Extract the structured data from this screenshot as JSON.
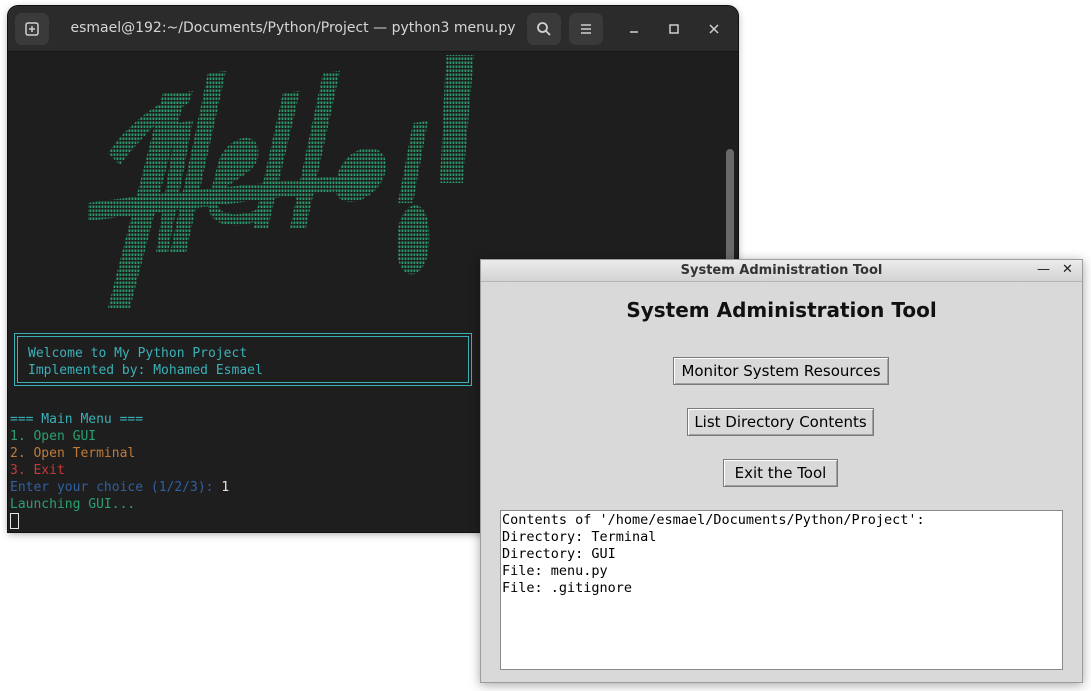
{
  "terminal": {
    "title": "esmael@192:~/Documents/Python/Project — python3 menu.py",
    "icons": {
      "new_tab": "new-tab-icon",
      "search": "search-icon",
      "menu": "hamburger-menu-icon",
      "minimize": "minimize-icon",
      "maximize": "maximize-icon",
      "close": "close-icon"
    },
    "welcome": {
      "line1": "Welcome to My Python Project",
      "line2": "Implemented by: Mohamed Esmael"
    },
    "menu": {
      "header": "=== Main Menu ===",
      "option1": "1. Open GUI",
      "option2": "2. Open Terminal",
      "option3": "3. Exit",
      "prompt": "Enter your choice (1/2/3): ",
      "choice": "1",
      "status": "Launching GUI..."
    },
    "colors": {
      "background": "#1e1e1e",
      "cyan": "#3bb0b8",
      "green": "#2aa070",
      "orange": "#c07a3a",
      "red": "#c23a3a",
      "blue": "#3060a0"
    }
  },
  "tk_window": {
    "title": "System Administration Tool",
    "heading": "System Administration Tool",
    "buttons": {
      "monitor": "Monitor System Resources",
      "list_dir": "List Directory Contents",
      "exit": "Exit the Tool"
    },
    "output_lines": [
      "Contents of '/home/esmael/Documents/Python/Project':",
      "Directory: Terminal",
      "Directory: GUI",
      "File: menu.py",
      "File: .gitignore"
    ]
  }
}
